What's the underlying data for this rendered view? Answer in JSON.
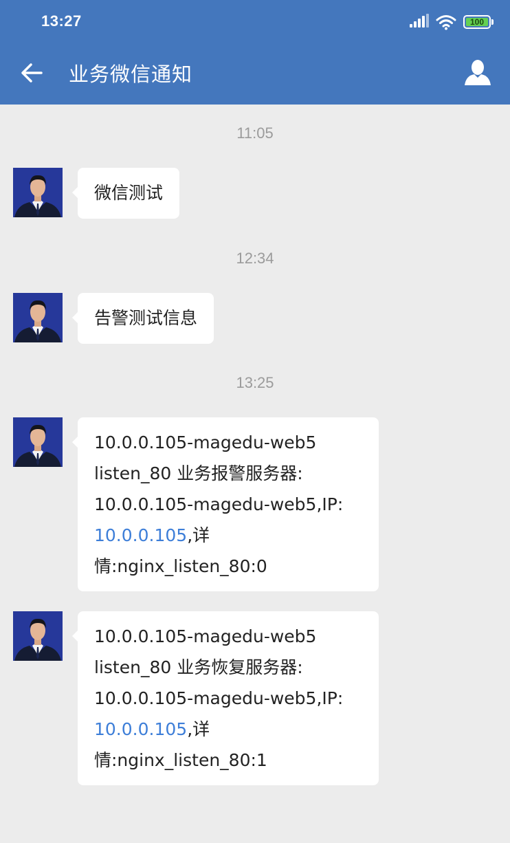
{
  "status_bar": {
    "time": "13:27",
    "battery": "100",
    "battery_color": "#64d052"
  },
  "header": {
    "title": "业务微信通知",
    "background": "#4477bd",
    "back_icon": "arrow-left-icon",
    "profile_icon": "person-icon"
  },
  "messages": [
    {
      "timestamp": "11:05",
      "text": "微信测试"
    },
    {
      "timestamp": "12:34",
      "text": "告警测试信息"
    },
    {
      "timestamp": "13:25",
      "line1": "10.0.0.105-magedu-web5",
      "line2": "listen_80 业务报警服务器:",
      "line3": "10.0.0.105-magedu-web5,IP:",
      "link": "10.0.0.105",
      "after_link": ",详",
      "line5": "情:nginx_listen_80:0"
    },
    {
      "line1": "10.0.0.105-magedu-web5",
      "line2": "listen_80 业务恢复服务器:",
      "line3": "10.0.0.105-magedu-web5,IP:",
      "link": "10.0.0.105",
      "after_link": ",详",
      "line5": "情:nginx_listen_80:1"
    }
  ],
  "colors": {
    "chat_background": "#ececec",
    "link": "#3d7ed8"
  }
}
